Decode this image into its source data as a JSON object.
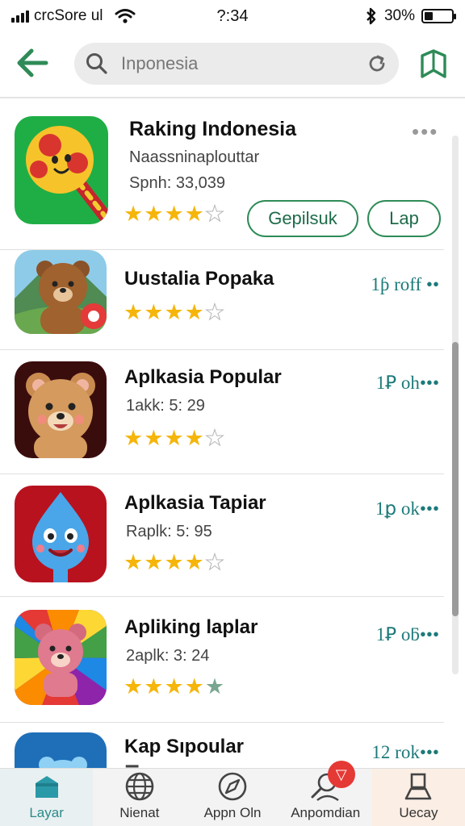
{
  "status_bar": {
    "carrier": "crcSore ul",
    "time": "?:34",
    "battery_text": "30%",
    "battery_level": 0.3
  },
  "search": {
    "placeholder": "Inponesia"
  },
  "apps": [
    {
      "name": "Raking Indonesia",
      "subtitle": "Naassninaplouttar",
      "detail": "Spnh: 33,039",
      "stars": 4,
      "actions": [
        "Gepilsuk",
        "Lap"
      ],
      "more": "•••"
    },
    {
      "name": "Uustalia Popaka",
      "stars": 4,
      "count": "1ƥ roff ••"
    },
    {
      "name": "Aplkasia Popular",
      "subtitle": "1akk: 5: 29",
      "stars": 4,
      "count": "1Ꝑ oh•••"
    },
    {
      "name": "Aplkasia Tapiar",
      "subtitle": "Raplk: 5: 95",
      "stars": 4,
      "count": "1ꝑ ok•••"
    },
    {
      "name": "Apliking laplar",
      "subtitle": "2aplk: 3: 24",
      "stars": 4,
      "count": "1Ꝑ oƃ•••"
    },
    {
      "name": "Kap Sıpoular",
      "count": "12 rok•••"
    }
  ],
  "bottom_nav": [
    {
      "label": "Layar",
      "icon": "store-icon",
      "active": true
    },
    {
      "label": "Nienat",
      "icon": "globe-icon"
    },
    {
      "label": "Appn Oln",
      "icon": "compass-icon"
    },
    {
      "label": "Anpomdian",
      "icon": "search-user-icon",
      "badge": "▽"
    },
    {
      "label": "Uecay",
      "icon": "user-icon"
    }
  ],
  "colors": {
    "accent": "#2e8b57",
    "star": "#f5b50a",
    "count_text": "#1d7a7a",
    "badge": "#e53935"
  }
}
